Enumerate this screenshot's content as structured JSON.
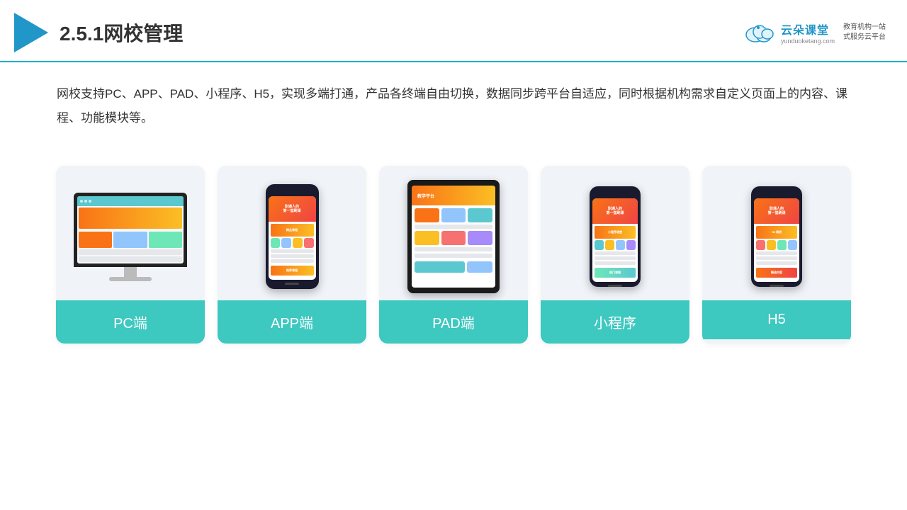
{
  "header": {
    "title": "2.5.1网校管理",
    "brand": {
      "name": "云朵课堂",
      "url": "yunduoketang.com",
      "slogan": "教育机构一站\n式服务云平台"
    }
  },
  "description": {
    "text": "网校支持PC、APP、PAD、小程序、H5，实现多端打通，产品各终端自由切换，数据同步跨平台自适应，同时根据机构需求自定义页面上的内容、课程、功能模块等。"
  },
  "cards": [
    {
      "id": "pc",
      "label": "PC端"
    },
    {
      "id": "app",
      "label": "APP端"
    },
    {
      "id": "pad",
      "label": "PAD端"
    },
    {
      "id": "miniprogram",
      "label": "小程序"
    },
    {
      "id": "h5",
      "label": "H5"
    }
  ],
  "colors": {
    "accent": "#3dc8c0",
    "header_border": "#1ab3c8",
    "text_primary": "#333333",
    "brand_blue": "#2196c8"
  }
}
